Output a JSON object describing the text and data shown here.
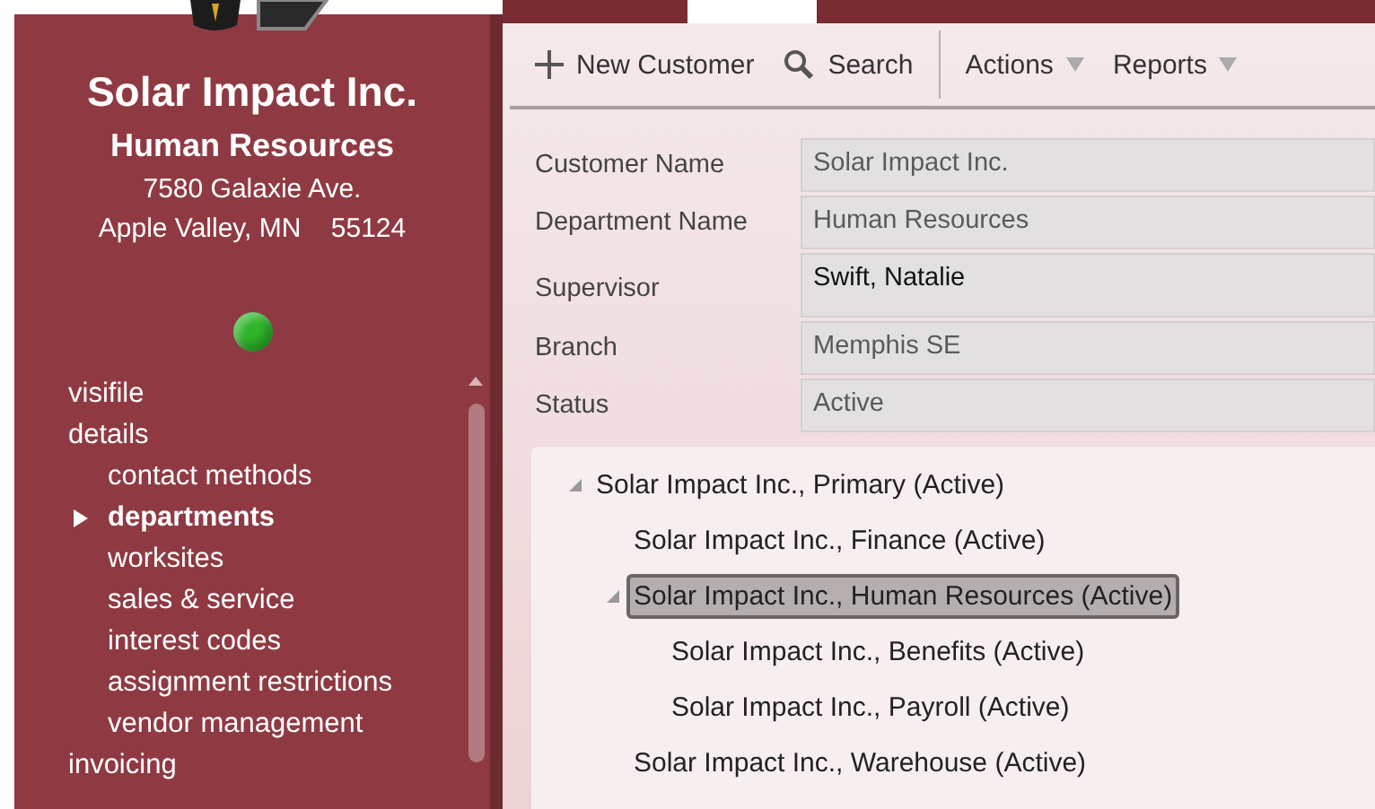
{
  "sidebar": {
    "title": "Solar Impact Inc.",
    "subtitle": "Human Resources",
    "address_line_1": "7580 Galaxie Ave.",
    "address_line_2": "Apple Valley, MN    55124",
    "nav": [
      {
        "label": "visifile",
        "selected": false
      },
      {
        "label": "details",
        "selected": false,
        "children": [
          {
            "label": "contact methods",
            "selected": false
          },
          {
            "label": "departments",
            "selected": true
          },
          {
            "label": "worksites",
            "selected": false
          },
          {
            "label": "sales & service",
            "selected": false
          },
          {
            "label": "interest codes",
            "selected": false
          },
          {
            "label": "assignment restrictions",
            "selected": false
          },
          {
            "label": "vendor management",
            "selected": false
          }
        ]
      },
      {
        "label": "invoicing",
        "selected": false
      }
    ]
  },
  "toolbar": {
    "buttons": [
      {
        "label": "New Customer",
        "kind": "add"
      },
      {
        "label": "Search",
        "kind": "search"
      }
    ],
    "menus": [
      {
        "label": "Actions"
      },
      {
        "label": "Reports"
      }
    ]
  },
  "form": [
    {
      "label": "Customer Name",
      "value": "Solar Impact Inc.",
      "readonly": true
    },
    {
      "label": "Department Name",
      "value": "Human Resources",
      "readonly": true
    },
    {
      "label": "Supervisor",
      "value": "Swift, Natalie",
      "readonly": false
    },
    {
      "label": "Branch",
      "value": "Memphis SE",
      "readonly": true
    },
    {
      "label": "Status",
      "value": "Active",
      "readonly": true
    }
  ],
  "tree": [
    {
      "label": "Solar Impact Inc., Primary (Active)",
      "selected": false,
      "expanded": true,
      "children": [
        {
          "label": "Solar Impact Inc., Finance (Active)",
          "selected": false
        },
        {
          "label": "Solar Impact Inc., Human Resources (Active)",
          "selected": true,
          "expanded": true,
          "children": [
            {
              "label": "Solar Impact Inc., Benefits (Active)",
              "selected": false
            },
            {
              "label": "Solar Impact Inc., Payroll (Active)",
              "selected": false
            }
          ]
        },
        {
          "label": "Solar Impact Inc., Warehouse (Active)",
          "selected": false
        }
      ]
    }
  ]
}
